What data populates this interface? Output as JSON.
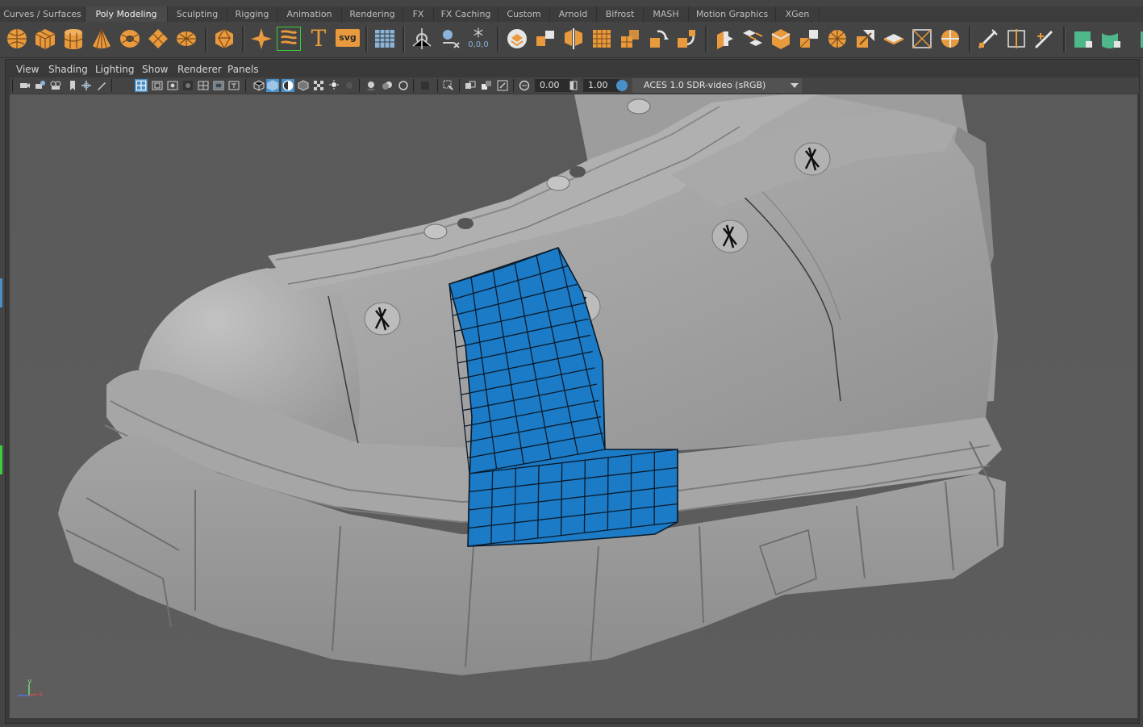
{
  "shelf_tabs": [
    "Curves / Surfaces",
    "Poly Modeling",
    "Sculpting",
    "Rigging",
    "Animation",
    "Rendering",
    "FX",
    "FX Caching",
    "Custom",
    "Arnold",
    "Bifrost",
    "MASH",
    "Motion Graphics",
    "XGen"
  ],
  "active_tab": "Poly Modeling",
  "shelf": {
    "text_tool_glyph": "T",
    "svg_tool_label": "svg",
    "snowflake_readout": "0,0,0"
  },
  "panel_menu": [
    "View",
    "Shading",
    "Lighting",
    "Show",
    "Renderer",
    "Panels"
  ],
  "viewport_toolbar": {
    "exposure_value": "0.00",
    "gamma_value": "1.00",
    "color_space": "ACES 1.0 SDR-video (sRGB)"
  },
  "axis": {
    "y_label": "y",
    "x_label": "x"
  },
  "colors": {
    "selection_blue": "#1b7bc6",
    "shelf_icon_orange": "#e89a3c",
    "shelf_icon_green": "#4fb88a",
    "active_toolbar_blue": "#4a90c8"
  }
}
